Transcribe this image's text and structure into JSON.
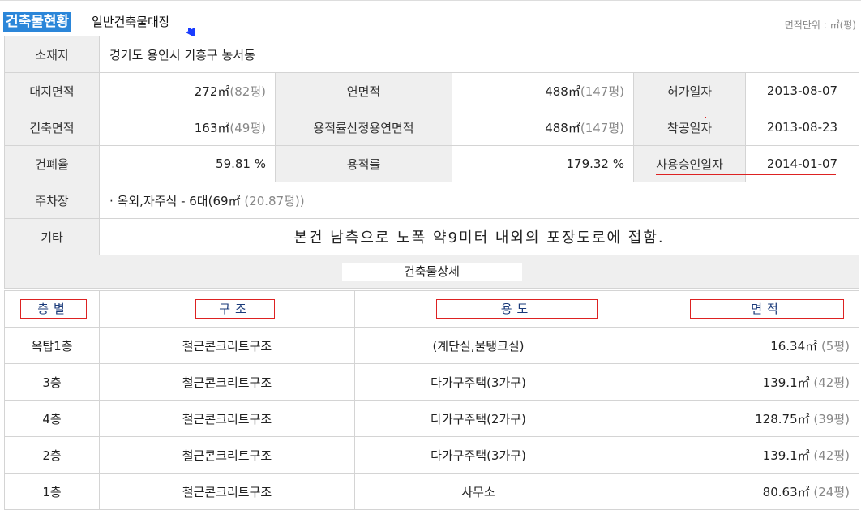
{
  "header": {
    "title": "건축물현황",
    "subtitle": "일반건축물대장",
    "unit_note": "면적단위 : ㎡(평)"
  },
  "info": {
    "location_label": "소재지",
    "location_value": "경기도 용인시 기흥구 농서동",
    "land_area_label": "대지면적",
    "land_area_m2": "272㎡",
    "land_area_py": "(82평)",
    "total_floor_area_label": "연면적",
    "total_floor_area_m2": "488㎡",
    "total_floor_area_py": "(147평)",
    "permit_date_label": "허가일자",
    "permit_date": "2013-08-07",
    "building_area_label": "건축면적",
    "building_area_m2": "163㎡",
    "building_area_py": "(49평)",
    "far_floor_area_label": "용적률산정용연면적",
    "far_floor_area_m2": "488㎡",
    "far_floor_area_py": "(147평)",
    "start_date_label": "착공일자",
    "start_date": "2013-08-23",
    "coverage_label": "건폐율",
    "coverage_value": "59.81 %",
    "far_label": "용적률",
    "far_value": "179.32 %",
    "approval_date_label": "사용승인일자",
    "approval_date": "2014-01-07",
    "parking_label": "주차장",
    "parking_value": "· 옥외,자주식 - 6대(69㎡",
    "parking_py": "(20.87평))",
    "other_label": "기타",
    "other_value": "본건 남측으로 노폭 약9미터 내외의 포장도로에 접함."
  },
  "detail": {
    "section_title": "건축물상세",
    "columns": [
      "층별",
      "구조",
      "용도",
      "면적"
    ],
    "rows": [
      {
        "floor": "옥탑1층",
        "structure": "철근콘크리트구조",
        "use": "(계단실,물탱크실)",
        "area_m2": "16.34㎡",
        "area_py": "(5평)"
      },
      {
        "floor": "3층",
        "structure": "철근콘크리트구조",
        "use": "다가구주택(3가구)",
        "area_m2": "139.1㎡",
        "area_py": "(42평)"
      },
      {
        "floor": "4층",
        "structure": "철근콘크리트구조",
        "use": "다가구주택(2가구)",
        "area_m2": "128.75㎡",
        "area_py": "(39평)"
      },
      {
        "floor": "2층",
        "structure": "철근콘크리트구조",
        "use": "다가구주택(3가구)",
        "area_m2": "139.1㎡",
        "area_py": "(42평)"
      },
      {
        "floor": "1층",
        "structure": "철근콘크리트구조",
        "use": "사무소",
        "area_m2": "80.63㎡",
        "area_py": "(24평)"
      }
    ]
  },
  "colors": {
    "accent": "#2b86d9",
    "label_bg": "#efefef",
    "annotation_red": "#dd2222",
    "header_text": "#1a3a7a"
  }
}
